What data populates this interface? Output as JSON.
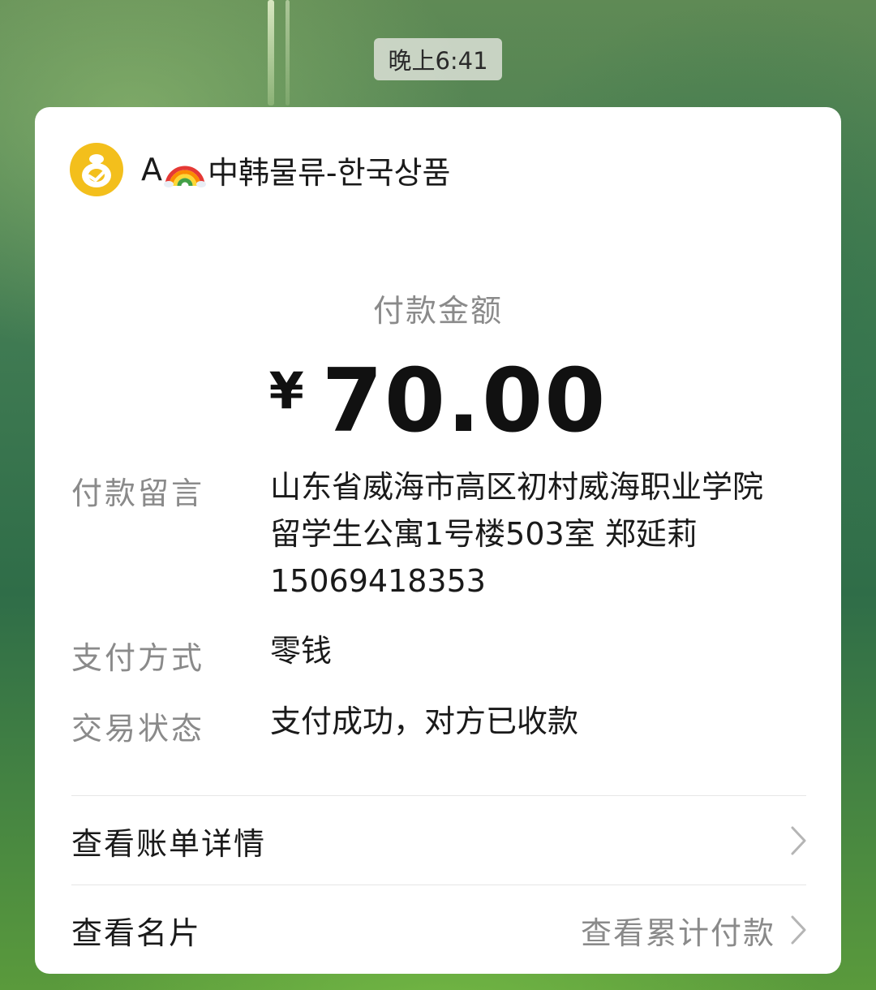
{
  "status": {
    "time": "晚上6:41"
  },
  "merchant": {
    "prefix": "A",
    "emoji_icon": "rainbow-icon",
    "name": "中韩물류-한국상품",
    "logo_icon": "wechat-pay-merchant-logo-icon"
  },
  "payment": {
    "amount_label": "付款金额",
    "currency": "¥",
    "amount": "70.00"
  },
  "details": {
    "note_label": "付款留言",
    "note_value": "山东省威海市高区初村威海职业学院留学生公寓1号楼503室  郑延莉15069418353",
    "method_label": "支付方式",
    "method_value": "零钱",
    "status_label": "交易状态",
    "status_value": "支付成功，对方已收款"
  },
  "links": {
    "bill_details": "查看账单详情",
    "business_card": "查看名片",
    "cumulative": "查看累计付款"
  },
  "colors": {
    "logo_yellow": "#f3bf1c",
    "primary_text": "#1a1a1a",
    "secondary_text": "#8a8a8a",
    "card_bg": "#ffffff"
  }
}
